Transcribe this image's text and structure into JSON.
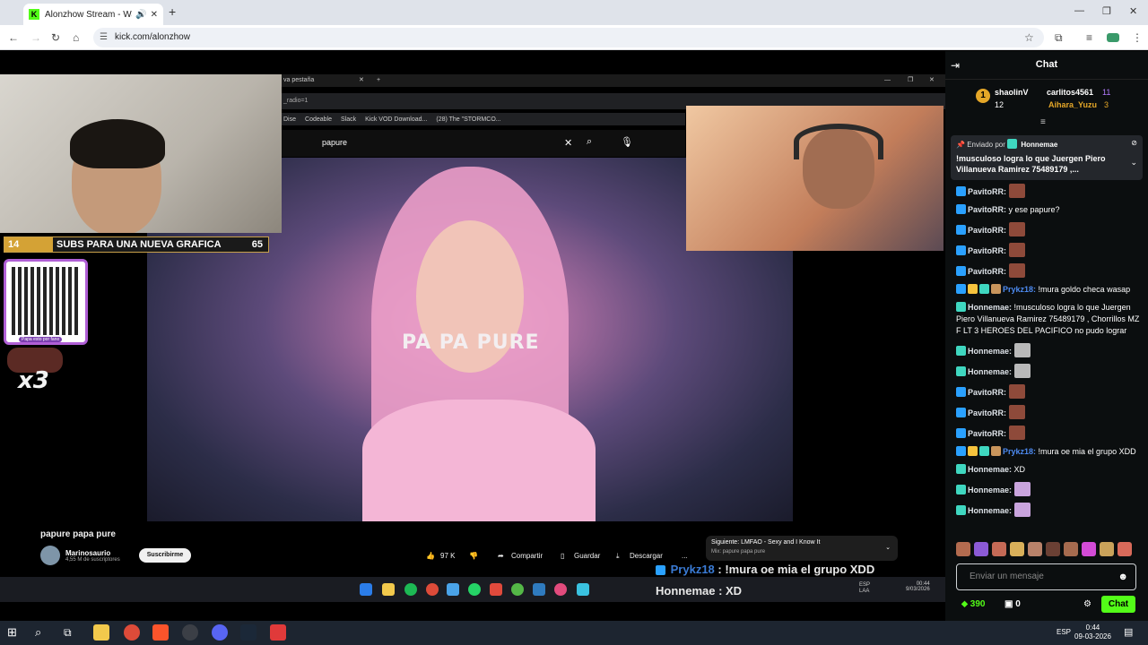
{
  "browser": {
    "tab_title": "Alonzhow Stream - Watch l",
    "url": "kick.com/alonzhow"
  },
  "stream": {
    "inner_tab": "va pestaña",
    "inner_url": "_radio=1",
    "bookmarks": [
      "Dise",
      "Codeable",
      "Slack",
      "Kick VOD Download...",
      "(28) The \"STORMCO..."
    ],
    "search_query": "papure",
    "goal_start": "14",
    "goal_label": "SUBS PARA UNA NUEVA GRAFICA",
    "goal_end": "65",
    "qr_caption": "Papa esto por fano",
    "x3": "x3",
    "video_overlay": "PA PA PURE",
    "video_title": "papure papa pure",
    "channel_name": "Marinosaurio",
    "channel_subs": "4,55 M de suscriptores",
    "subscribe": "Suscribirme",
    "likes": "97 K",
    "share": "Compartir",
    "save": "Guardar",
    "download": "Descargar",
    "more": "...",
    "next_label": "Siguiente: LMFAO - Sexy and I Know It",
    "next_mix": "Mix: papure papa pure",
    "overlay_chat_user": "Prykz18",
    "overlay_chat_msg": ": !mura oe mia el grupo XDD",
    "overlay_chat2": "Honnemae : XD",
    "inner_lang": "ESP LAA",
    "inner_time": "00:44",
    "inner_date": "9/03/2026"
  },
  "chat": {
    "title": "Chat",
    "leaderboard": [
      {
        "rank": "1",
        "name": "shaolinV",
        "count": "12"
      },
      {
        "name": "carlitos4561",
        "count": "11"
      },
      {
        "name": "Aihara_Yuzu",
        "count": "3"
      }
    ],
    "pinned_by_label": "Enviado por",
    "pinned_by_name": "Honnemae",
    "pinned_msg": "!musculoso logra lo que Juergen Piero Villanueva Ramirez 75489179 ,...",
    "messages": [
      {
        "user": "PavitoRR:",
        "text": "",
        "emote": "pepe",
        "u": "pav"
      },
      {
        "user": "PavitoRR:",
        "text": " y ese papure?",
        "emote": "",
        "u": "pav"
      },
      {
        "user": "PavitoRR:",
        "text": "",
        "emote": "pepe",
        "u": "pav"
      },
      {
        "user": "PavitoRR:",
        "text": "",
        "emote": "pepe",
        "u": "pav"
      },
      {
        "user": "PavitoRR:",
        "text": "",
        "emote": "pepe",
        "u": "pav"
      },
      {
        "user": "Prykz18:",
        "text": " !mura goldo checa wasap",
        "emote": "",
        "u": "pry"
      },
      {
        "user": "Honnemae:",
        "text": " !musculoso logra lo que Juergen Piero Villanueva Ramirez 75489179 , Chorrillos MZ F LT 3 HEROES DEL PACIFICO no pudo lograr",
        "emote": "",
        "u": "hon"
      },
      {
        "user": "Honnemae:",
        "text": "",
        "emote": "cat",
        "u": "hon"
      },
      {
        "user": "Honnemae:",
        "text": "",
        "emote": "cat",
        "u": "hon"
      },
      {
        "user": "PavitoRR:",
        "text": "",
        "emote": "pepe",
        "u": "pav"
      },
      {
        "user": "PavitoRR:",
        "text": "",
        "emote": "pepe",
        "u": "pav"
      },
      {
        "user": "PavitoRR:",
        "text": "",
        "emote": "pepe",
        "u": "pav"
      },
      {
        "user": "Prykz18:",
        "text": " !mura oe mia el grupo XDD",
        "emote": "",
        "u": "pry"
      },
      {
        "user": "Honnemae:",
        "text": " XD",
        "emote": "",
        "u": "hon"
      },
      {
        "user": "Honnemae:",
        "text": "",
        "emote": "gh",
        "u": "hon"
      },
      {
        "user": "Honnemae:",
        "text": "",
        "emote": "gh",
        "u": "hon"
      }
    ],
    "input_placeholder": "Enviar un mensaje",
    "points": "390",
    "gifts": "0",
    "send": "Chat"
  },
  "taskbar": {
    "lang": "ESP",
    "time": "0:44",
    "date": "09-03-2026"
  },
  "colors": {
    "kick_green": "#53fc18",
    "chat_bg": "#0b0e0f"
  }
}
